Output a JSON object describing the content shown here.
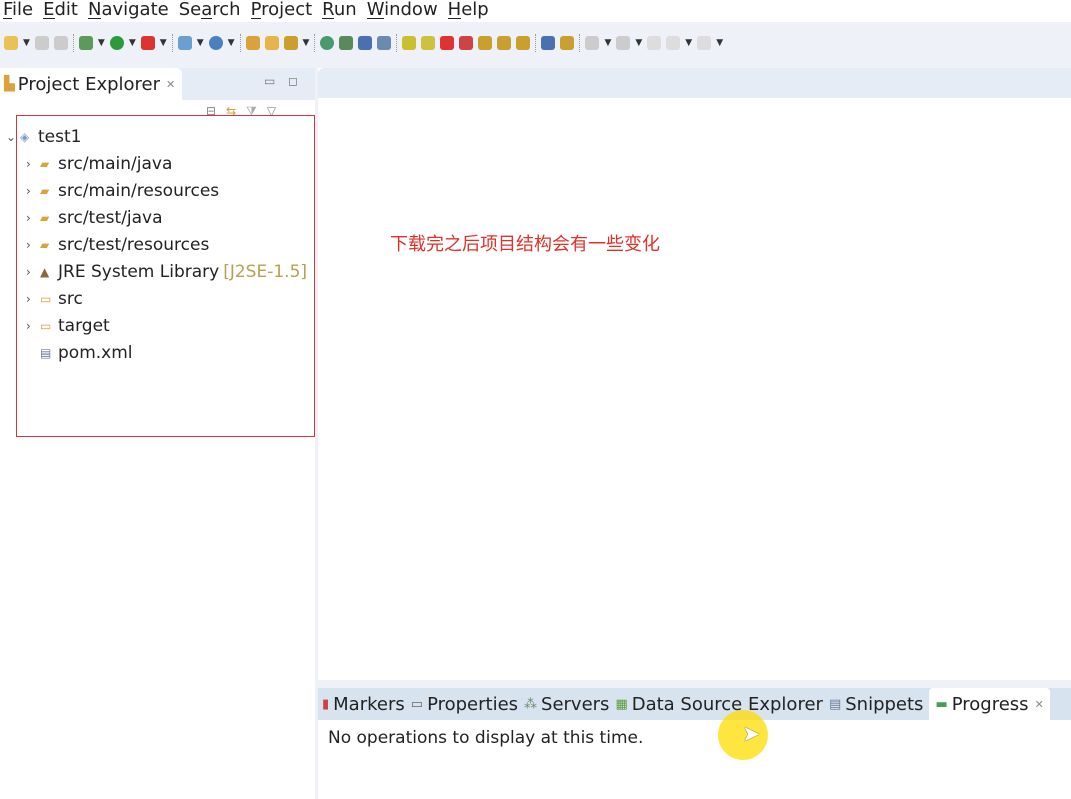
{
  "menu": [
    "File",
    "Edit",
    "Navigate",
    "Search",
    "Project",
    "Run",
    "Window",
    "Help"
  ],
  "menu_mnemonics": [
    "F",
    "E",
    "N",
    "a",
    "P",
    "R",
    "W",
    "H"
  ],
  "project_explorer": {
    "title": "Project Explorer",
    "tree": [
      {
        "label": "test1",
        "decoration": "",
        "icon": "project-icon",
        "expanded": true,
        "level": 0
      },
      {
        "label": "src/main/java",
        "decoration": "",
        "icon": "source-folder-icon",
        "level": 1
      },
      {
        "label": "src/main/resources",
        "decoration": "",
        "icon": "source-folder-icon",
        "level": 1
      },
      {
        "label": "src/test/java",
        "decoration": "",
        "icon": "source-folder-icon",
        "level": 1
      },
      {
        "label": "src/test/resources",
        "decoration": "",
        "icon": "source-folder-icon",
        "level": 1
      },
      {
        "label": "JRE System Library",
        "decoration": "[J2SE-1.5]",
        "icon": "library-icon",
        "level": 1
      },
      {
        "label": "src",
        "decoration": "",
        "icon": "folder-icon",
        "level": 1
      },
      {
        "label": "target",
        "decoration": "",
        "icon": "folder-icon",
        "level": 1
      },
      {
        "label": "pom.xml",
        "decoration": "",
        "icon": "xml-file-icon",
        "level": 1,
        "leaf": true
      }
    ]
  },
  "annotation": "下载完之后项目结构会有一些变化",
  "bottom_panel": {
    "tabs": [
      {
        "label": "Markers",
        "icon": "markers-icon"
      },
      {
        "label": "Properties",
        "icon": "properties-icon"
      },
      {
        "label": "Servers",
        "icon": "servers-icon"
      },
      {
        "label": "Data Source Explorer",
        "icon": "data-source-icon"
      },
      {
        "label": "Snippets",
        "icon": "snippets-icon"
      },
      {
        "label": "Progress",
        "icon": "progress-icon",
        "active": true
      }
    ],
    "message": "No operations to display at this time."
  },
  "colors": {
    "annotation": "#e0302a",
    "highlight_box": "#d9343a"
  }
}
